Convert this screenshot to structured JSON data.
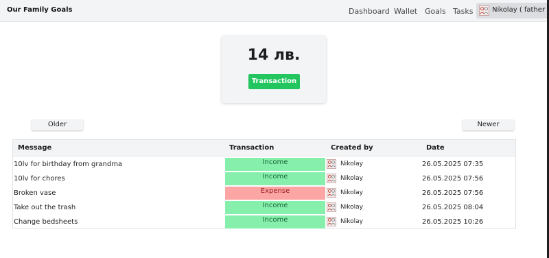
{
  "app": {
    "brand": "Our Family Goals"
  },
  "nav": {
    "links": [
      "Dashboard",
      "Wallet",
      "Goals",
      "Tasks"
    ],
    "user": "Nikolay ( father )"
  },
  "wallet": {
    "balance": "14 лв.",
    "transaction_button": "Transaction"
  },
  "pager": {
    "older": "Older",
    "newer": "Newer"
  },
  "table": {
    "headers": [
      "Message",
      "Transaction",
      "Created by",
      "Date"
    ],
    "rows": [
      {
        "message": "10lv for birthday from grandma",
        "type": "Income",
        "kind": "income",
        "created_by": "Nikolay",
        "date": "26.05.2025 07:35"
      },
      {
        "message": "10lv for chores",
        "type": "Income",
        "kind": "income",
        "created_by": "Nikolay",
        "date": "26.05.2025 07:56"
      },
      {
        "message": "Broken vase",
        "type": "Expense",
        "kind": "expense",
        "created_by": "Nikolay",
        "date": "26.05.2025 07:56"
      },
      {
        "message": "Take out the trash",
        "type": "Income",
        "kind": "income",
        "created_by": "Nikolay",
        "date": "26.05.2025 08:04"
      },
      {
        "message": "Change bedsheets",
        "type": "Income",
        "kind": "income",
        "created_by": "Nikolay",
        "date": "26.05.2025 10:26"
      }
    ]
  },
  "colors": {
    "income": "#86efac",
    "expense": "#fca5a5",
    "primary": "#22c55e"
  }
}
